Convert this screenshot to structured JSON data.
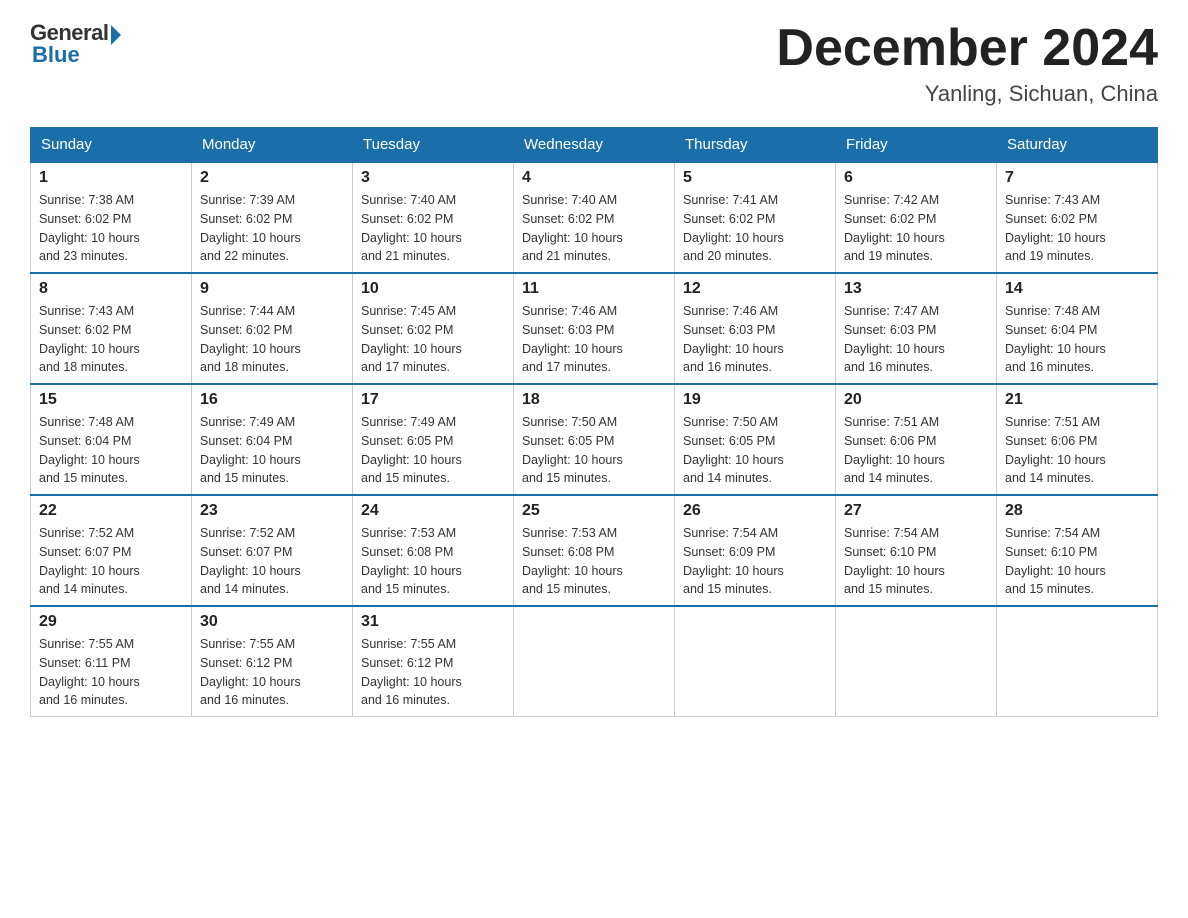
{
  "logo": {
    "general": "General",
    "blue": "Blue"
  },
  "title": "December 2024",
  "location": "Yanling, Sichuan, China",
  "days_of_week": [
    "Sunday",
    "Monday",
    "Tuesday",
    "Wednesday",
    "Thursday",
    "Friday",
    "Saturday"
  ],
  "weeks": [
    [
      {
        "day": "1",
        "sunrise": "7:38 AM",
        "sunset": "6:02 PM",
        "daylight": "10 hours and 23 minutes."
      },
      {
        "day": "2",
        "sunrise": "7:39 AM",
        "sunset": "6:02 PM",
        "daylight": "10 hours and 22 minutes."
      },
      {
        "day": "3",
        "sunrise": "7:40 AM",
        "sunset": "6:02 PM",
        "daylight": "10 hours and 21 minutes."
      },
      {
        "day": "4",
        "sunrise": "7:40 AM",
        "sunset": "6:02 PM",
        "daylight": "10 hours and 21 minutes."
      },
      {
        "day": "5",
        "sunrise": "7:41 AM",
        "sunset": "6:02 PM",
        "daylight": "10 hours and 20 minutes."
      },
      {
        "day": "6",
        "sunrise": "7:42 AM",
        "sunset": "6:02 PM",
        "daylight": "10 hours and 19 minutes."
      },
      {
        "day": "7",
        "sunrise": "7:43 AM",
        "sunset": "6:02 PM",
        "daylight": "10 hours and 19 minutes."
      }
    ],
    [
      {
        "day": "8",
        "sunrise": "7:43 AM",
        "sunset": "6:02 PM",
        "daylight": "10 hours and 18 minutes."
      },
      {
        "day": "9",
        "sunrise": "7:44 AM",
        "sunset": "6:02 PM",
        "daylight": "10 hours and 18 minutes."
      },
      {
        "day": "10",
        "sunrise": "7:45 AM",
        "sunset": "6:02 PM",
        "daylight": "10 hours and 17 minutes."
      },
      {
        "day": "11",
        "sunrise": "7:46 AM",
        "sunset": "6:03 PM",
        "daylight": "10 hours and 17 minutes."
      },
      {
        "day": "12",
        "sunrise": "7:46 AM",
        "sunset": "6:03 PM",
        "daylight": "10 hours and 16 minutes."
      },
      {
        "day": "13",
        "sunrise": "7:47 AM",
        "sunset": "6:03 PM",
        "daylight": "10 hours and 16 minutes."
      },
      {
        "day": "14",
        "sunrise": "7:48 AM",
        "sunset": "6:04 PM",
        "daylight": "10 hours and 16 minutes."
      }
    ],
    [
      {
        "day": "15",
        "sunrise": "7:48 AM",
        "sunset": "6:04 PM",
        "daylight": "10 hours and 15 minutes."
      },
      {
        "day": "16",
        "sunrise": "7:49 AM",
        "sunset": "6:04 PM",
        "daylight": "10 hours and 15 minutes."
      },
      {
        "day": "17",
        "sunrise": "7:49 AM",
        "sunset": "6:05 PM",
        "daylight": "10 hours and 15 minutes."
      },
      {
        "day": "18",
        "sunrise": "7:50 AM",
        "sunset": "6:05 PM",
        "daylight": "10 hours and 15 minutes."
      },
      {
        "day": "19",
        "sunrise": "7:50 AM",
        "sunset": "6:05 PM",
        "daylight": "10 hours and 14 minutes."
      },
      {
        "day": "20",
        "sunrise": "7:51 AM",
        "sunset": "6:06 PM",
        "daylight": "10 hours and 14 minutes."
      },
      {
        "day": "21",
        "sunrise": "7:51 AM",
        "sunset": "6:06 PM",
        "daylight": "10 hours and 14 minutes."
      }
    ],
    [
      {
        "day": "22",
        "sunrise": "7:52 AM",
        "sunset": "6:07 PM",
        "daylight": "10 hours and 14 minutes."
      },
      {
        "day": "23",
        "sunrise": "7:52 AM",
        "sunset": "6:07 PM",
        "daylight": "10 hours and 14 minutes."
      },
      {
        "day": "24",
        "sunrise": "7:53 AM",
        "sunset": "6:08 PM",
        "daylight": "10 hours and 15 minutes."
      },
      {
        "day": "25",
        "sunrise": "7:53 AM",
        "sunset": "6:08 PM",
        "daylight": "10 hours and 15 minutes."
      },
      {
        "day": "26",
        "sunrise": "7:54 AM",
        "sunset": "6:09 PM",
        "daylight": "10 hours and 15 minutes."
      },
      {
        "day": "27",
        "sunrise": "7:54 AM",
        "sunset": "6:10 PM",
        "daylight": "10 hours and 15 minutes."
      },
      {
        "day": "28",
        "sunrise": "7:54 AM",
        "sunset": "6:10 PM",
        "daylight": "10 hours and 15 minutes."
      }
    ],
    [
      {
        "day": "29",
        "sunrise": "7:55 AM",
        "sunset": "6:11 PM",
        "daylight": "10 hours and 16 minutes."
      },
      {
        "day": "30",
        "sunrise": "7:55 AM",
        "sunset": "6:12 PM",
        "daylight": "10 hours and 16 minutes."
      },
      {
        "day": "31",
        "sunrise": "7:55 AM",
        "sunset": "6:12 PM",
        "daylight": "10 hours and 16 minutes."
      },
      null,
      null,
      null,
      null
    ]
  ],
  "labels": {
    "sunrise": "Sunrise:",
    "sunset": "Sunset:",
    "daylight": "Daylight:"
  }
}
